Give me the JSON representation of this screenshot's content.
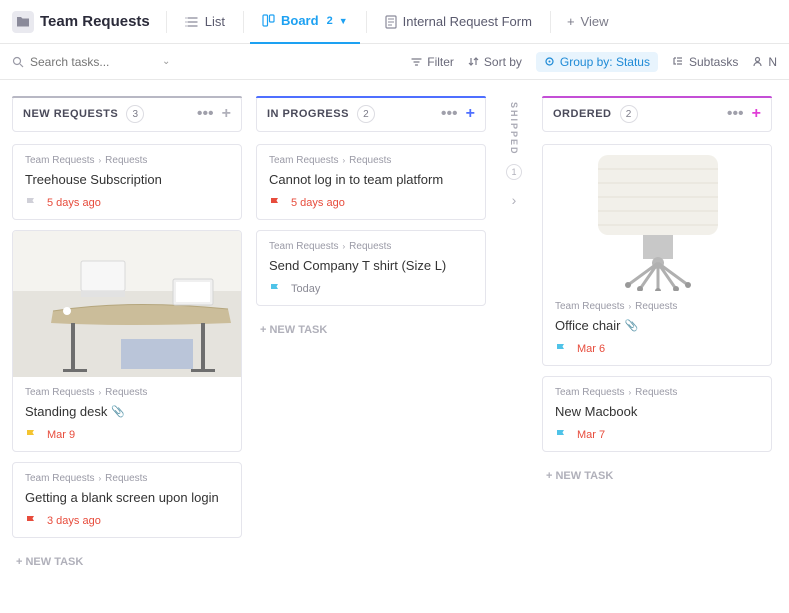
{
  "header": {
    "title": "Team Requests",
    "tabs": [
      {
        "label": "List"
      },
      {
        "label": "Board",
        "badge": "2",
        "active": true
      },
      {
        "label": "Internal Request Form"
      }
    ],
    "addView": "View"
  },
  "toolbar": {
    "searchPlaceholder": "Search tasks...",
    "filter": "Filter",
    "sortBy": "Sort by",
    "groupBy": "Group by: Status",
    "subtasks": "Subtasks",
    "more": "N"
  },
  "columns": [
    {
      "title": "NEW REQUESTS",
      "count": "3",
      "accent": "gray",
      "plusColor": "gray",
      "cards": [
        {
          "breadcrumb": [
            "Team Requests",
            "Requests"
          ],
          "title": "Treehouse Subscription",
          "date": "5 days ago",
          "dateColor": "red",
          "flag": "gray"
        },
        {
          "breadcrumb": [
            "Team Requests",
            "Requests"
          ],
          "title": "Standing desk",
          "attach": true,
          "date": "Mar 9",
          "dateColor": "red",
          "flag": "yellow",
          "image": "desk"
        },
        {
          "breadcrumb": [
            "Team Requests",
            "Requests"
          ],
          "title": "Getting a blank screen upon login",
          "date": "3 days ago",
          "dateColor": "red",
          "flag": "red"
        }
      ],
      "newTask": "+ NEW TASK"
    },
    {
      "title": "IN PROGRESS",
      "count": "2",
      "accent": "blue",
      "plusColor": "blue",
      "cards": [
        {
          "breadcrumb": [
            "Team Requests",
            "Requests"
          ],
          "title": "Cannot log in to team platform",
          "date": "5 days ago",
          "dateColor": "red",
          "flag": "red"
        },
        {
          "breadcrumb": [
            "Team Requests",
            "Requests"
          ],
          "title": "Send Company T shirt (Size L)",
          "date": "Today",
          "dateColor": "gray",
          "flag": "cyan"
        }
      ],
      "newTask": "+ NEW TASK"
    }
  ],
  "collapsedColumn": {
    "title": "SHIPPED",
    "count": "1"
  },
  "orderedColumn": {
    "title": "ORDERED",
    "count": "2",
    "accent": "purple",
    "plusColor": "magenta",
    "cards": [
      {
        "breadcrumb": [
          "Team Requests",
          "Requests"
        ],
        "title": "Office chair",
        "attach": true,
        "date": "Mar 6",
        "dateColor": "red",
        "flag": "cyan",
        "image": "chair"
      },
      {
        "breadcrumb": [
          "Team Requests",
          "Requests"
        ],
        "title": "New Macbook",
        "date": "Mar 7",
        "dateColor": "red",
        "flag": "cyan"
      }
    ],
    "newTask": "+ NEW TASK"
  }
}
